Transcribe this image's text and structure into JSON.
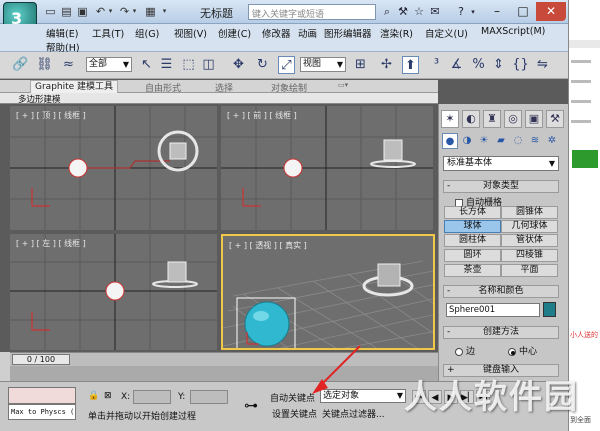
{
  "app": {
    "title": "无标题",
    "search_placeholder": "键入关键字或短语",
    "logo_glyph": "3"
  },
  "quick_access": [
    "new-icon",
    "open-icon",
    "save-icon",
    "undo-icon",
    "redo-icon",
    "open-file-icon"
  ],
  "menus": {
    "row1": [
      "编辑(E)",
      "工具(T)",
      "组(G)",
      "视图(V)",
      "创建(C)",
      "修改器",
      "动画",
      "图形编辑器",
      "渲染(R)",
      "自定义(U)",
      "MAXScript(M)"
    ],
    "row2": [
      "帮助(H)"
    ]
  },
  "toolbar": {
    "selection_filter": "全部",
    "ref_coord": "视图"
  },
  "ribbon": {
    "tabs": [
      "Graphite 建模工具",
      "自由形式",
      "选择",
      "对象绘制"
    ],
    "active_tab": "Graphite 建模工具",
    "panel_label": "多边形建模"
  },
  "viewports": {
    "top": "[ + ] [ 顶 ] [ 线框 ]",
    "front": "[ + ] [ 前 ] [ 线框 ]",
    "left": "[ + ] [ 左 ] [ 线框 ]",
    "persp": "[ + ] [ 透视 ] [ 真实 ]"
  },
  "command_panel": {
    "dropdown": "标准基本体",
    "rollout_object_type": "对象类型",
    "auto_grid": "自动栅格",
    "buttons": [
      "长方体",
      "圆锥体",
      "球体",
      "几何球体",
      "圆柱体",
      "管状体",
      "圆环",
      "四棱锥",
      "茶壶",
      "平面"
    ],
    "active_button": "球体",
    "rollout_name_color": "名称和颜色",
    "object_name": "Sphere001",
    "rollout_creation": "创建方法",
    "radio_edge": "边",
    "radio_center": "中心",
    "selected_radio": "中心",
    "rollout_keyboard": "键盘输入",
    "accent_color": "#1f7d8a"
  },
  "timeline": {
    "position": "0 / 100"
  },
  "status": {
    "maxscript": "Max to Physcs (",
    "x_label": "X:",
    "y_label": "Y:",
    "message": "单击并拖动以开始创建过程",
    "auto_key": "自动关键点",
    "set_key": "设置关键点",
    "key_filter_select": "选定对象",
    "key_filters": "关键点过滤器..."
  },
  "watermark": "人人软件园",
  "background_window": {
    "snippets": [
      "小人送的",
      "到全面"
    ]
  }
}
